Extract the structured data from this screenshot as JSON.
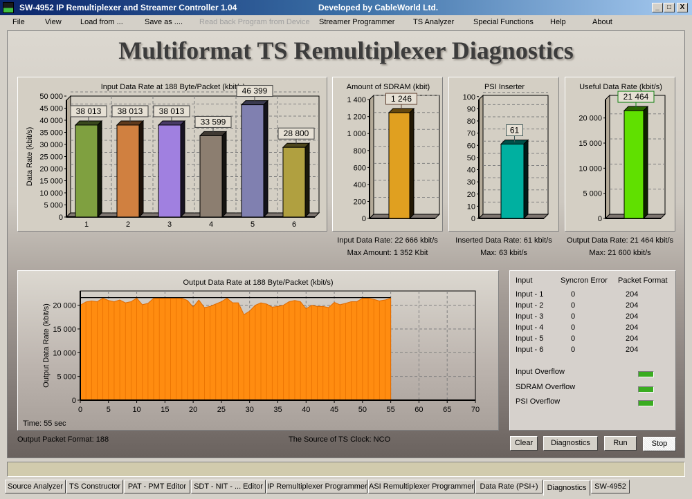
{
  "window": {
    "title": "SW-4952  IP Remultiplexer and Streamer  Controller   1.04",
    "developer": "Developed by CableWorld Ltd.",
    "controls": [
      "_",
      "□",
      "X"
    ]
  },
  "menu": [
    "File",
    "View",
    "Load from ...",
    "Save as ....",
    "Read back Program from Device",
    "Streamer Programmer",
    "TS Analyzer",
    "Special Functions",
    "Help",
    "About"
  ],
  "menu_disabled": "Read back Program from Device",
  "page_title": "Multiformat TS Remultiplexer Diagnostics",
  "chart_data": [
    {
      "type": "bar",
      "title": "Input Data Rate at 188 Byte/Packet    (kbit/s)",
      "ylabel": "Data Rate (kbit/s)",
      "categories": [
        "1",
        "2",
        "3",
        "4",
        "5",
        "6"
      ],
      "values": [
        38013,
        38013,
        38013,
        33599,
        46399,
        28800
      ],
      "value_labels": [
        "38 013",
        "38 013",
        "38 013",
        "33 599",
        "46 399",
        "28 800"
      ],
      "colors": [
        "#7fa040",
        "#d08040",
        "#a080e0",
        "#8c7e70",
        "#8080b0",
        "#b0a040"
      ],
      "ylim": [
        0,
        50000
      ],
      "yticks": [
        "0",
        "5 000",
        "10 000",
        "15 000",
        "20 000",
        "25 000",
        "30 000",
        "35 000",
        "40 000",
        "45 000",
        "50 000"
      ],
      "grid": true
    },
    {
      "type": "bar",
      "title": "Amount of SDRAM (kbit)",
      "categories": [
        ""
      ],
      "values": [
        1246
      ],
      "value_labels": [
        "1 246"
      ],
      "colors": [
        "#e0a020"
      ],
      "ylim": [
        0,
        1450
      ],
      "yticks": [
        "0",
        "200",
        "400",
        "600",
        "800",
        "1 000",
        "1 200",
        "1 400"
      ],
      "grid": true
    },
    {
      "type": "bar",
      "title": "PSI Inserter",
      "categories": [
        ""
      ],
      "values": [
        61
      ],
      "value_labels": [
        "61"
      ],
      "colors": [
        "#00b0a0"
      ],
      "ylim": [
        0,
        101
      ],
      "yticks": [
        "0",
        "10",
        "20",
        "30",
        "40",
        "50",
        "60",
        "70",
        "80",
        "90",
        "100"
      ],
      "grid": true
    },
    {
      "type": "bar",
      "title": "Useful Data Rate (kbit/s)",
      "categories": [
        ""
      ],
      "values": [
        21464
      ],
      "value_labels": [
        "21 464"
      ],
      "colors": [
        "#60e000"
      ],
      "ylim": [
        0,
        24500
      ],
      "yticks": [
        "0",
        "5 000",
        "10 000",
        "15 000",
        "20 000"
      ],
      "grid": true
    },
    {
      "type": "area",
      "title": "Output Data Rate at 188 Byte/Packet    (kbit/s)",
      "ylabel": "Output Data Rate (kbit/s)",
      "x": [
        0,
        1,
        2,
        3,
        4,
        5,
        6,
        7,
        8,
        9,
        10,
        11,
        12,
        13,
        14,
        15,
        16,
        17,
        18,
        19,
        20,
        21,
        22,
        23,
        24,
        25,
        26,
        27,
        28,
        29,
        30,
        31,
        32,
        33,
        34,
        35,
        36,
        37,
        38,
        39,
        40,
        41,
        42,
        43,
        44,
        45,
        46,
        47,
        48,
        49,
        50,
        51,
        52,
        53,
        54,
        55
      ],
      "y": [
        20000,
        20700,
        20900,
        20750,
        21480,
        21000,
        20750,
        21100,
        20500,
        20750,
        21480,
        20100,
        20400,
        21480,
        21480,
        21480,
        21480,
        21480,
        21480,
        21000,
        19600,
        21100,
        19500,
        19750,
        20250,
        20750,
        21480,
        20500,
        20500,
        18000,
        18760,
        20000,
        20500,
        20250,
        19600,
        19750,
        20000,
        20750,
        21000,
        20750,
        19250,
        20000,
        19750,
        19750,
        19500,
        20600,
        20100,
        20400,
        20750,
        20750,
        21480,
        21480,
        21230,
        20900,
        21100,
        21480
      ],
      "max_line": 21600,
      "color": "#ff8c10",
      "xlim": [
        0,
        70
      ],
      "ylim": [
        0,
        23000
      ],
      "xticks": [
        "0",
        "5",
        "10",
        "15",
        "20",
        "25",
        "30",
        "35",
        "40",
        "45",
        "50",
        "55",
        "60",
        "65",
        "70"
      ],
      "yticks": [
        "0",
        "5 000",
        "10 000",
        "15 000",
        "20 000"
      ],
      "grid": true
    }
  ],
  "captions": {
    "sdram": [
      "Input Data Rate: 22 666 kbit/s",
      "Max Amount: 1 352 Kbit"
    ],
    "psi": [
      "Inserted Data Rate: 61 kbit/s",
      "Max: 63 kbit/s"
    ],
    "useful": [
      "Output Data Rate: 21 464 kbit/s",
      "Max: 21 600 kbit/s"
    ],
    "time": "Time: 55 sec",
    "packet_format": "Output Packet Format: 188",
    "ts_clock": "The Source of TS Clock: NCO"
  },
  "status_table": {
    "headers": [
      "Input",
      "Syncron Error",
      "Packet Format"
    ],
    "rows": [
      [
        "Input - 1",
        "0",
        "204"
      ],
      [
        "Input - 2",
        "0",
        "204"
      ],
      [
        "Input - 3",
        "0",
        "204"
      ],
      [
        "Input - 4",
        "0",
        "204"
      ],
      [
        "Input - 5",
        "0",
        "204"
      ],
      [
        "Input - 6",
        "0",
        "204"
      ]
    ],
    "overflows": [
      "Input Overflow",
      "SDRAM Overflow",
      "PSI Overflow"
    ],
    "led_color": "#3aac20"
  },
  "buttons": [
    "Clear",
    "Diagnostics",
    "Run",
    "Stop"
  ],
  "tabs": [
    "Source Analyzer",
    "TS Constructor",
    "PAT - PMT  Editor",
    "SDT - NIT - ... Editor",
    "IP Remultiplexer Programmer",
    "ASI Remultiplexer Programmer",
    "Data Rate   (PSI+)",
    "Diagnostics",
    "SW-4952"
  ],
  "active_tab": "Diagnostics"
}
